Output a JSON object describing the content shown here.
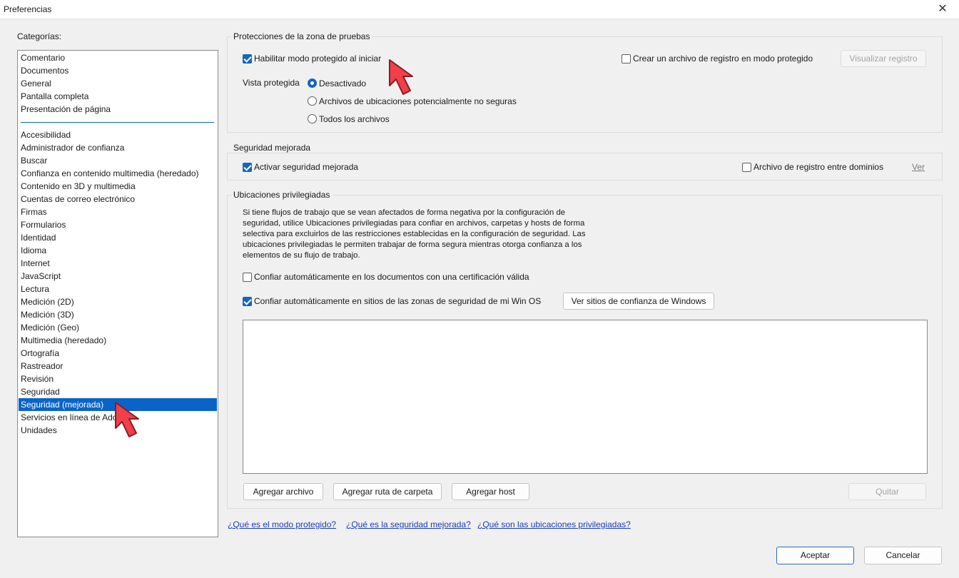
{
  "window": {
    "title": "Preferencias"
  },
  "sidebar": {
    "label": "Categorías:",
    "top_items": [
      "Comentario",
      "Documentos",
      "General",
      "Pantalla completa",
      "Presentación de página"
    ],
    "items": [
      "Accesibilidad",
      "Administrador de confianza",
      "Buscar",
      "Confianza en contenido multimedia (heredado)",
      "Contenido en 3D y multimedia",
      "Cuentas de correo electrónico",
      "Firmas",
      "Formularios",
      "Identidad",
      "Idioma",
      "Internet",
      "JavaScript",
      "Lectura",
      "Medición (2D)",
      "Medición (3D)",
      "Medición (Geo)",
      "Multimedia (heredado)",
      "Ortografía",
      "Rastreador",
      "Revisión",
      "Seguridad",
      "Seguridad (mejorada)",
      "Servicios en línea de Adobe",
      "Unidades"
    ],
    "selected": "Seguridad (mejorada)"
  },
  "sandbox": {
    "title": "Protecciones de la zona de pruebas",
    "protected_mode_label": "Habilitar modo protegido al iniciar",
    "protected_mode_checked": true,
    "log_file_label": "Crear un archivo de registro en modo protegido",
    "log_file_checked": false,
    "view_log_button": "Visualizar registro",
    "protected_view_label": "Vista protegida",
    "radio_options": [
      "Desactivado",
      "Archivos de ubicaciones potencialmente no seguras",
      "Todos los archivos"
    ],
    "radio_selected": "Desactivado"
  },
  "enhanced": {
    "title": "Seguridad mejorada",
    "enable_label": "Activar seguridad mejorada",
    "enable_checked": true,
    "crossdomain_label": "Archivo de registro entre dominios",
    "crossdomain_checked": false,
    "view_link": "Ver"
  },
  "privileged": {
    "title": "Ubicaciones privilegiadas",
    "description": "Si tiene flujos de trabajo que se vean afectados de forma negativa por la configuración de seguridad, utilice Ubicaciones privilegiadas para confiar en archivos, carpetas y hosts de forma selectiva para excluirlos de las restricciones establecidas en la configuración de seguridad. Las ubicaciones privilegiadas le permiten trabajar de forma segura mientras otorga confianza a los elementos de su flujo de trabajo.",
    "cert_label": "Confiar automáticamente en los documentos con una certificación válida",
    "cert_checked": false,
    "winos_label": "Confiar automáticamente en sitios de las zonas de seguridad de mi Win OS",
    "winos_checked": true,
    "windows_sites_button": "Ver sitios de confianza de Windows",
    "add_file_button": "Agregar archivo",
    "add_folder_button": "Agregar ruta de carpeta",
    "add_host_button": "Agregar host",
    "remove_button": "Quitar"
  },
  "help_links": [
    "¿Qué es el modo protegido?",
    "¿Qué es la seguridad mejorada?",
    "¿Qué son las ubicaciones privilegiadas?"
  ],
  "footer": {
    "ok_button": "Aceptar",
    "cancel_button": "Cancelar"
  },
  "icons": {
    "close": "close-icon",
    "annotation": "red-arrow-cursor-icon"
  },
  "colors": {
    "selection": "#0a64c8",
    "checkbox": "#1565c0",
    "link": "#1a3dbd",
    "annotation": "#f0404a"
  }
}
